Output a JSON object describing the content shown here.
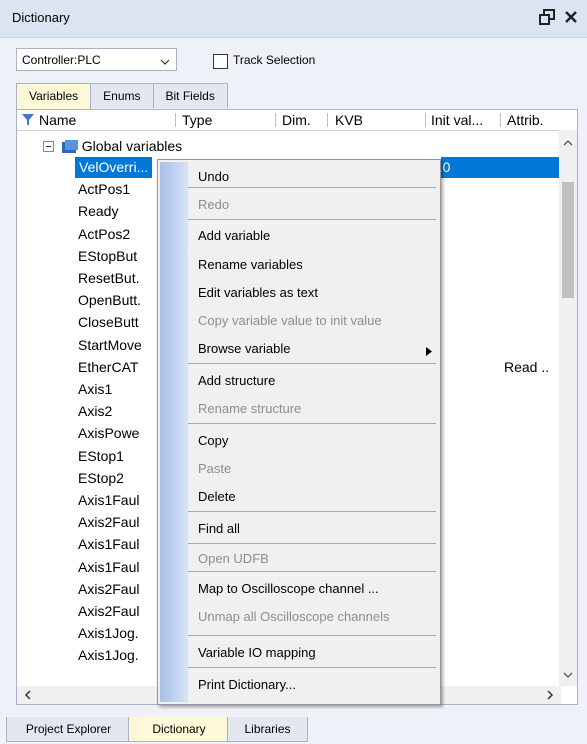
{
  "window": {
    "title": "Dictionary"
  },
  "toolbar": {
    "controller": "Controller:PLC",
    "track_selection_label": "Track Selection"
  },
  "tabs": [
    "Variables",
    "Enums",
    "Bit Fields"
  ],
  "columns": [
    "Name",
    "Type",
    "Dim.",
    "KVB",
    "Init val...",
    "Attrib."
  ],
  "tree": {
    "group": "Global variables",
    "rows": [
      {
        "name": "VelOverri...",
        "init": "0.0",
        "attrib": ""
      },
      {
        "name": "ActPos1",
        "init": "",
        "attrib": ""
      },
      {
        "name": "Ready",
        "init": "",
        "attrib": ""
      },
      {
        "name": "ActPos2",
        "init": "",
        "attrib": ""
      },
      {
        "name": "EStopBut",
        "init": "",
        "attrib": ""
      },
      {
        "name": "ResetBut.",
        "init": "",
        "attrib": ""
      },
      {
        "name": "OpenButt.",
        "init": "",
        "attrib": ""
      },
      {
        "name": "CloseButt",
        "init": "",
        "attrib": ""
      },
      {
        "name": "StartMove",
        "init": "",
        "attrib": ""
      },
      {
        "name": "EtherCAT",
        "init": "",
        "attrib": "Read .."
      },
      {
        "name": "Axis1",
        "init": "",
        "attrib": ""
      },
      {
        "name": "Axis2",
        "init": "",
        "attrib": ""
      },
      {
        "name": "AxisPowe",
        "init": "",
        "attrib": ""
      },
      {
        "name": "EStop1",
        "init": "",
        "attrib": ""
      },
      {
        "name": "EStop2",
        "init": "",
        "attrib": ""
      },
      {
        "name": "Axis1Faul",
        "init": "",
        "attrib": ""
      },
      {
        "name": "Axis2Faul",
        "init": "",
        "attrib": ""
      },
      {
        "name": "Axis1Faul",
        "init": "",
        "attrib": ""
      },
      {
        "name": "Axis1Faul",
        "init": "",
        "attrib": ""
      },
      {
        "name": "Axis2Faul",
        "init": "",
        "attrib": ""
      },
      {
        "name": "Axis2Faul",
        "init": "",
        "attrib": ""
      },
      {
        "name": "Axis1Jog.",
        "init": "",
        "attrib": ""
      },
      {
        "name": "Axis1Jog.",
        "init": "",
        "attrib": ""
      }
    ]
  },
  "context_menu": {
    "items": [
      {
        "label": "Undo",
        "enabled": true
      },
      {
        "label": "Redo",
        "enabled": false
      },
      {
        "label": "Add variable",
        "enabled": true
      },
      {
        "label": "Rename variables",
        "enabled": true
      },
      {
        "label": "Edit variables as text",
        "enabled": true
      },
      {
        "label": "Copy variable value to init value",
        "enabled": false
      },
      {
        "label": "Browse variable",
        "enabled": true,
        "submenu": true
      },
      {
        "label": "Add structure",
        "enabled": true
      },
      {
        "label": "Rename structure",
        "enabled": false
      },
      {
        "label": "Copy",
        "enabled": true
      },
      {
        "label": "Paste",
        "enabled": false
      },
      {
        "label": "Delete",
        "enabled": true
      },
      {
        "label": "Find all",
        "enabled": true
      },
      {
        "label": "Open UDFB",
        "enabled": false
      },
      {
        "label": "Map to Oscilloscope channel ...",
        "enabled": true
      },
      {
        "label": "Unmap all Oscilloscope channels",
        "enabled": false
      },
      {
        "label": "Variable IO mapping",
        "enabled": true
      },
      {
        "label": "Print Dictionary...",
        "enabled": true
      }
    ]
  },
  "bottom_tabs": [
    "Project Explorer",
    "Dictionary",
    "Libraries"
  ],
  "colors": {
    "selection": "#0078d7",
    "active_tab": "#fff8d8",
    "menu_gutter": "#a7bfe8"
  }
}
